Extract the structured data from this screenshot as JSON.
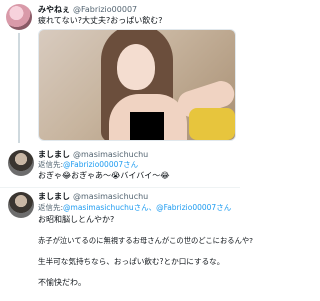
{
  "tweet1": {
    "name": "みやねぇ",
    "handle": "@Fabrizio00007",
    "text": "疲れてない?大丈夫?おっぱい飲む?"
  },
  "tweet2": {
    "name": "ましまし",
    "handle": "@masimasichuchu",
    "reply_prefix": "返信先:",
    "reply_to": "@Fabrizio00007さん",
    "text": "おぎゃ😂おぎゃあ〜😭バイバイ〜😂"
  },
  "tweet3": {
    "name": "ましまし",
    "handle": "@masimasichuchu",
    "reply_prefix": "返信先:",
    "reply_to": "@masimasichuchuさん、@Fabrizio00007さん",
    "lines": [
      "お昭和脳しとんやか?",
      "",
      "赤子が泣いてるのに無視するお母さんがこの世のどこにおるんや?",
      "",
      "生半可な気持ちなら、おっぱい飲む?とか口にするな。",
      "",
      "不愉快だわ。"
    ]
  },
  "colors": {
    "accent": "#1d9bf0",
    "secondary_text": "#536471",
    "censor": "#000000"
  }
}
